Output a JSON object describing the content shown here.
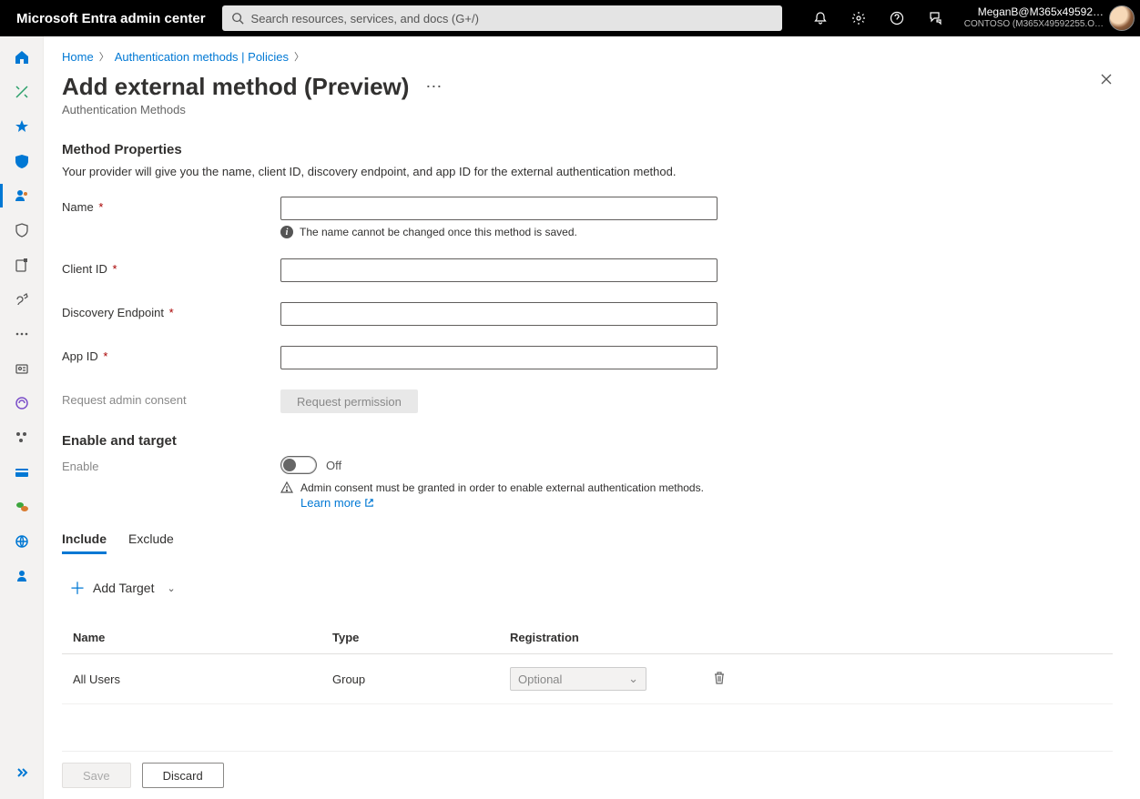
{
  "header": {
    "brand": "Microsoft Entra admin center",
    "search_placeholder": "Search resources, services, and docs (G+/)",
    "account_name": "MeganB@M365x49592…",
    "account_tenant": "CONTOSO (M365X49592255.O…"
  },
  "breadcrumb": {
    "items": [
      "Home",
      "Authentication methods | Policies"
    ]
  },
  "page": {
    "title": "Add external method (Preview)",
    "subtitle": "Authentication Methods"
  },
  "method_properties": {
    "section_title": "Method Properties",
    "description": "Your provider will give you the name, client ID, discovery endpoint, and app ID for the external authentication method.",
    "name_label": "Name",
    "name_info": "The name cannot be changed once this method is saved.",
    "client_id_label": "Client ID",
    "discovery_label": "Discovery Endpoint",
    "app_id_label": "App ID",
    "request_consent_label": "Request admin consent",
    "request_permission_btn": "Request permission"
  },
  "enable_target": {
    "section_title": "Enable and target",
    "enable_label": "Enable",
    "toggle_state": "Off",
    "warn_text": "Admin consent must be granted in order to enable external authentication methods.",
    "learn_more": "Learn more"
  },
  "tabs": {
    "include": "Include",
    "exclude": "Exclude"
  },
  "add_target_label": "Add Target",
  "table": {
    "head_name": "Name",
    "head_type": "Type",
    "head_reg": "Registration",
    "rows": [
      {
        "name": "All Users",
        "type": "Group",
        "registration": "Optional"
      }
    ]
  },
  "footer": {
    "save": "Save",
    "discard": "Discard"
  }
}
